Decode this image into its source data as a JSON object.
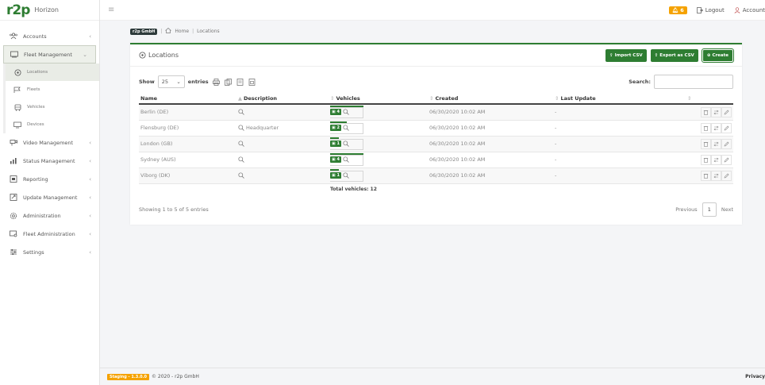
{
  "app": {
    "name": "Horizon"
  },
  "topbar": {
    "notification_count": "6",
    "logout": "Logout",
    "account": "Account"
  },
  "sidebar": {
    "items": [
      {
        "label": "Accounts",
        "icon": "users-icon"
      },
      {
        "label": "Fleet Management",
        "icon": "fleet-icon"
      },
      {
        "label": "Video Management",
        "icon": "camera-icon"
      },
      {
        "label": "Status Management",
        "icon": "chart-icon"
      },
      {
        "label": "Reporting",
        "icon": "report-icon"
      },
      {
        "label": "Update Management",
        "icon": "update-icon"
      },
      {
        "label": "Administration",
        "icon": "gear-icon"
      },
      {
        "label": "Fleet Administration",
        "icon": "fleet-admin-icon"
      },
      {
        "label": "Settings",
        "icon": "sliders-icon"
      }
    ],
    "subitems": [
      {
        "label": "Locations"
      },
      {
        "label": "Fleets"
      },
      {
        "label": "Vehicles"
      },
      {
        "label": "Devices"
      }
    ]
  },
  "breadcrumb": {
    "company": "r2p GmbH",
    "home": "Home",
    "current": "Locations"
  },
  "card": {
    "title": "Locations",
    "import_csv": "Import CSV",
    "export_csv": "Export as CSV",
    "create": "Create"
  },
  "toolbar": {
    "show": "Show",
    "entries_value": "25",
    "entries": "entries",
    "search": "Search:"
  },
  "table": {
    "headers": [
      "Name",
      "Description",
      "Vehicles",
      "Created",
      "Last Update"
    ],
    "rows": [
      {
        "name": "Berlin (DE)",
        "description": "",
        "vehicles": "4",
        "vehicle_fill": 1.0,
        "created": "06/30/2020 10:02 AM",
        "last_update": "-"
      },
      {
        "name": "Flensburg (DE)",
        "description": "Headquarter",
        "vehicles": "2",
        "vehicle_fill": 0.5,
        "created": "06/30/2020 10:02 AM",
        "last_update": "-"
      },
      {
        "name": "London (GB)",
        "description": "",
        "vehicles": "1",
        "vehicle_fill": 0.25,
        "created": "06/30/2020 10:02 AM",
        "last_update": "-"
      },
      {
        "name": "Sydney (AUS)",
        "description": "",
        "vehicles": "4",
        "vehicle_fill": 1.0,
        "created": "06/30/2020 10:02 AM",
        "last_update": "-"
      },
      {
        "name": "Viborg (DK)",
        "description": "",
        "vehicles": "1",
        "vehicle_fill": 0.25,
        "created": "06/30/2020 10:02 AM",
        "last_update": "-"
      }
    ],
    "total": "Total vehicles: 12"
  },
  "pagination": {
    "showing": "Showing 1 to 5 of 5 entries",
    "previous": "Previous",
    "page": "1",
    "next": "Next"
  },
  "footer": {
    "staging": "Staging - 1.3.0.0",
    "copyright": "© 2020 - r2p GmbH",
    "privacy": "Privacy"
  }
}
